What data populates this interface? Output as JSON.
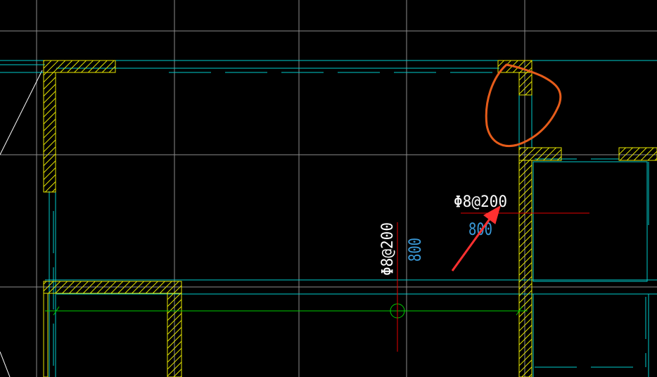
{
  "app": {
    "view": "CAD model space"
  },
  "colors": {
    "background": "#000000",
    "grid": "#8c8c8c",
    "wall_outline": "#e6e600",
    "wall_hatch": "#e6e600",
    "cyan_line": "#00cccc",
    "dim_green": "#00cc00",
    "rebar_red": "#e60000",
    "label_white": "#ffffff",
    "label_blue": "#3a9ad9",
    "markup_orange": "#e65c1a",
    "arrow_red": "#ff3030"
  },
  "annotations": {
    "horizontal_rebar": {
      "spec": "Φ8@200",
      "length": "800"
    },
    "vertical_rebar": {
      "spec": "Φ8@200",
      "length": "800"
    }
  },
  "markup": {
    "circle_icon": "freehand-circle",
    "arrow_icon": "arrow-pointer"
  }
}
